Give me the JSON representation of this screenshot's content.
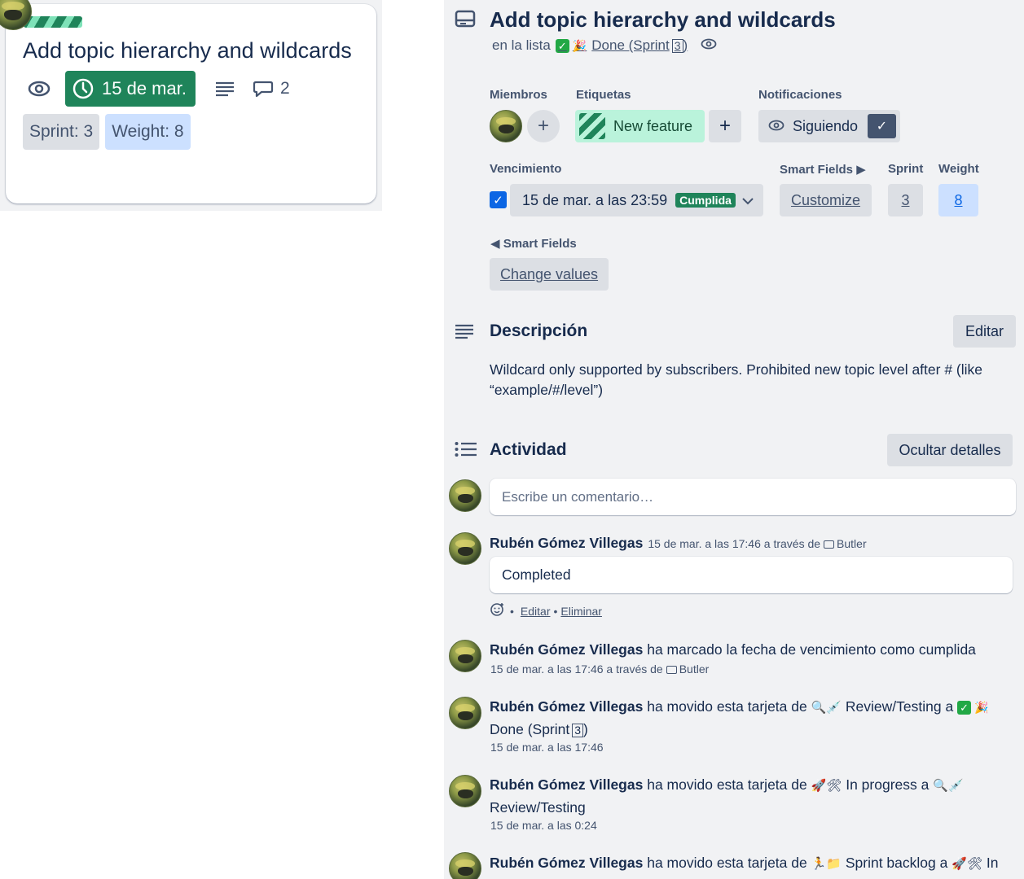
{
  "card": {
    "title": "Add topic hierarchy and wildcards",
    "due": "15 de mar.",
    "comment_count": "2",
    "sprint_pill": "Sprint: 3",
    "weight_pill": "Weight: 8",
    "colors": {
      "due": "#1f845a",
      "label": "#1f845a"
    }
  },
  "detail": {
    "title": "Add topic hierarchy and wildcards",
    "in_list_prefix": "en la lista",
    "list_name": "Done (Sprint",
    "list_sprint": "3",
    "list_suffix": ")",
    "members_label": "Miembros",
    "labels_label": "Etiquetas",
    "label_name": "New feature",
    "notifications_label": "Notificaciones",
    "follow_label": "Siguiendo",
    "due_label": "Vencimiento",
    "due_value": "15 de mar. a las 23:59",
    "due_status": "Cumplida",
    "smart_fields_label": "Smart Fields ▶",
    "customize_label": "Customize",
    "sprint_label": "Sprint",
    "sprint_value": "3",
    "weight_label": "Weight",
    "weight_value": "8",
    "smart_fields_back": "◀ Smart Fields",
    "change_values_label": "Change values",
    "description_title": "Descripción",
    "edit_label": "Editar",
    "description_text": "Wildcard only supported by subscribers. Prohibited new topic level after # (like “example/#/level”)",
    "activity_title": "Actividad",
    "hide_details_label": "Ocultar detalles",
    "comment_placeholder": "Escribe un comentario…"
  },
  "activity": [
    {
      "user": "Rubén Gómez Villegas",
      "meta": "15 de mar. a las 17:46 a través de",
      "via": "Butler",
      "comment": "Completed",
      "edit": "Editar",
      "delete": "Eliminar"
    },
    {
      "user": "Rubén Gómez Villegas",
      "text": "ha marcado la fecha de vencimiento como cumplida",
      "meta": "15 de mar. a las 17:46 a través de",
      "via": "Butler"
    },
    {
      "user": "Rubén Gómez Villegas",
      "text": "ha movido esta tarjeta de",
      "from": "Review/Testing",
      "to_word": "a",
      "to": "Done (Sprint",
      "to_num": "3",
      "to_suffix": ")",
      "meta": "15 de mar. a las 17:46"
    },
    {
      "user": "Rubén Gómez Villegas",
      "text": "ha movido esta tarjeta de",
      "from": "In progress",
      "to_word": "a",
      "to": "Review/Testing",
      "meta": "15 de mar. a las 0:24"
    },
    {
      "user": "Rubén Gómez Villegas",
      "text": "ha movido esta tarjeta de",
      "from": "Sprint backlog",
      "to_word": "a",
      "to": "In"
    }
  ]
}
